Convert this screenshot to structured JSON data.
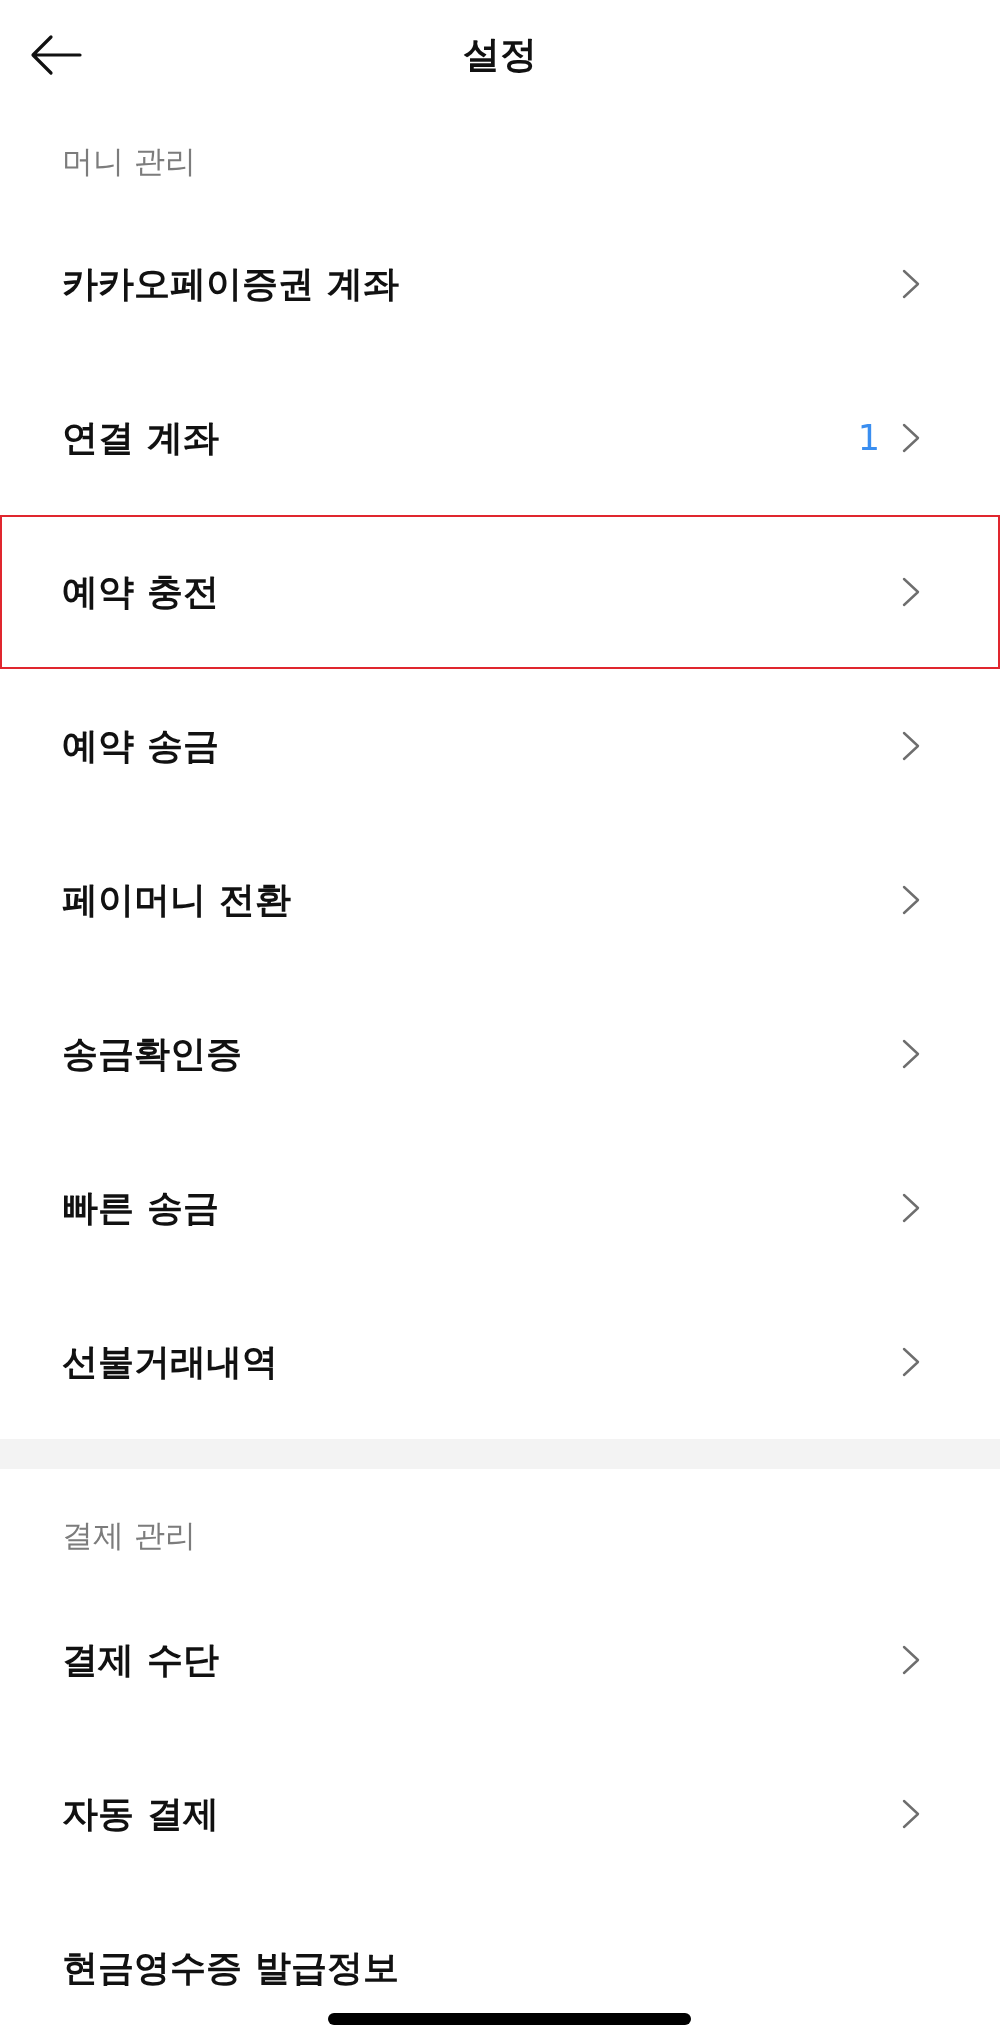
{
  "header": {
    "title": "설정"
  },
  "sections": [
    {
      "title": "머니 관리",
      "rows": [
        {
          "label": "카카오페이증권 계좌",
          "highlighted": false,
          "chevron": true
        },
        {
          "label": "연결 계좌",
          "count": "1",
          "highlighted": false,
          "chevron": true
        },
        {
          "label": "예약 충전",
          "highlighted": true,
          "chevron": true
        },
        {
          "label": "예약 송금",
          "highlighted": false,
          "chevron": true
        },
        {
          "label": "페이머니 전환",
          "highlighted": false,
          "chevron": true
        },
        {
          "label": "송금확인증",
          "highlighted": false,
          "chevron": true
        },
        {
          "label": "빠른 송금",
          "highlighted": false,
          "chevron": true
        },
        {
          "label": "선불거래내역",
          "highlighted": false,
          "chevron": true
        }
      ]
    },
    {
      "title": "결제 관리",
      "rows": [
        {
          "label": "결제 수단",
          "highlighted": false,
          "chevron": true
        },
        {
          "label": "자동 결제",
          "highlighted": false,
          "chevron": true
        },
        {
          "label": "현금영수증 발급정보",
          "highlighted": false,
          "chevron": false
        }
      ]
    }
  ]
}
